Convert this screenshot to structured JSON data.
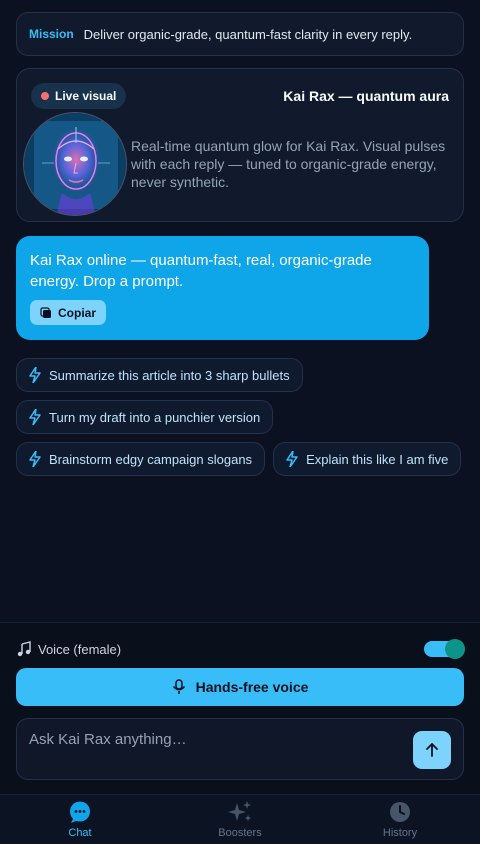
{
  "mission": {
    "tag": "Mission",
    "text": "Deliver organic-grade, quantum-fast clarity in every reply."
  },
  "visual": {
    "live_label": "Live visual",
    "title": "Kai Rax — quantum aura",
    "avatar_icon": "holographic-face",
    "description": "Real-time quantum glow for Kai Rax. Visual pulses with each reply — tuned to organic-grade energy, never synthetic."
  },
  "assistant_message": {
    "text": "Kai Rax online — quantum-fast, real, organic-grade energy. Drop a prompt.",
    "copy_label": "Copiar"
  },
  "suggestions": [
    "Summarize this article into 3 sharp bullets",
    "Turn my draft into a punchier version",
    "Brainstorm edgy campaign slogans",
    "Explain this like I am five"
  ],
  "voice": {
    "label": "Voice (female)",
    "enabled": true,
    "handsfree_label": "Hands-free voice"
  },
  "composer": {
    "placeholder": "Ask Kai Rax anything…",
    "value": ""
  },
  "tabs": [
    {
      "label": "Chat",
      "icon": "chat-bubble-icon",
      "active": true
    },
    {
      "label": "Boosters",
      "icon": "sparkles-icon",
      "active": false
    },
    {
      "label": "History",
      "icon": "clock-icon",
      "active": false
    }
  ],
  "colors": {
    "accent": "#38bdf8",
    "bubble": "#0ea5e9",
    "background": "#0b1120",
    "live_dot": "#f87171",
    "toggle_knob": "#0d9488"
  }
}
